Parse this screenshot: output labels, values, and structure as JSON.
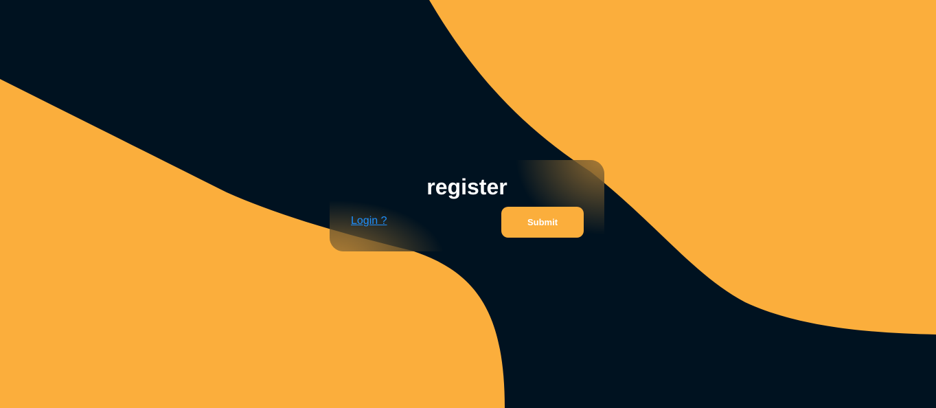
{
  "colors": {
    "background": "#001220",
    "accent": "#fbae3c",
    "link": "#1e90ff",
    "text": "#ffffff"
  },
  "form": {
    "title": "register",
    "login_link": "Login ?",
    "submit_label": "Submit"
  }
}
